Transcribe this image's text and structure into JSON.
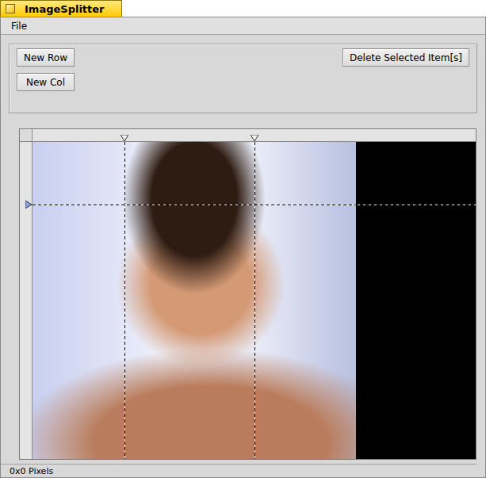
{
  "window": {
    "title": "ImageSplitter"
  },
  "menu": [
    {
      "label": "File"
    }
  ],
  "buttons": {
    "new_row": "New Row",
    "new_col": "New Col",
    "delete": "Delete Selected Item[s]"
  },
  "canvas": {
    "columns": [
      {
        "level": 0.285,
        "selected": false
      },
      {
        "level": 0.686,
        "selected": false
      }
    ],
    "rows": [
      {
        "level": 0.198,
        "selected": false
      }
    ]
  },
  "status_bar": "0x0 Pixels"
}
